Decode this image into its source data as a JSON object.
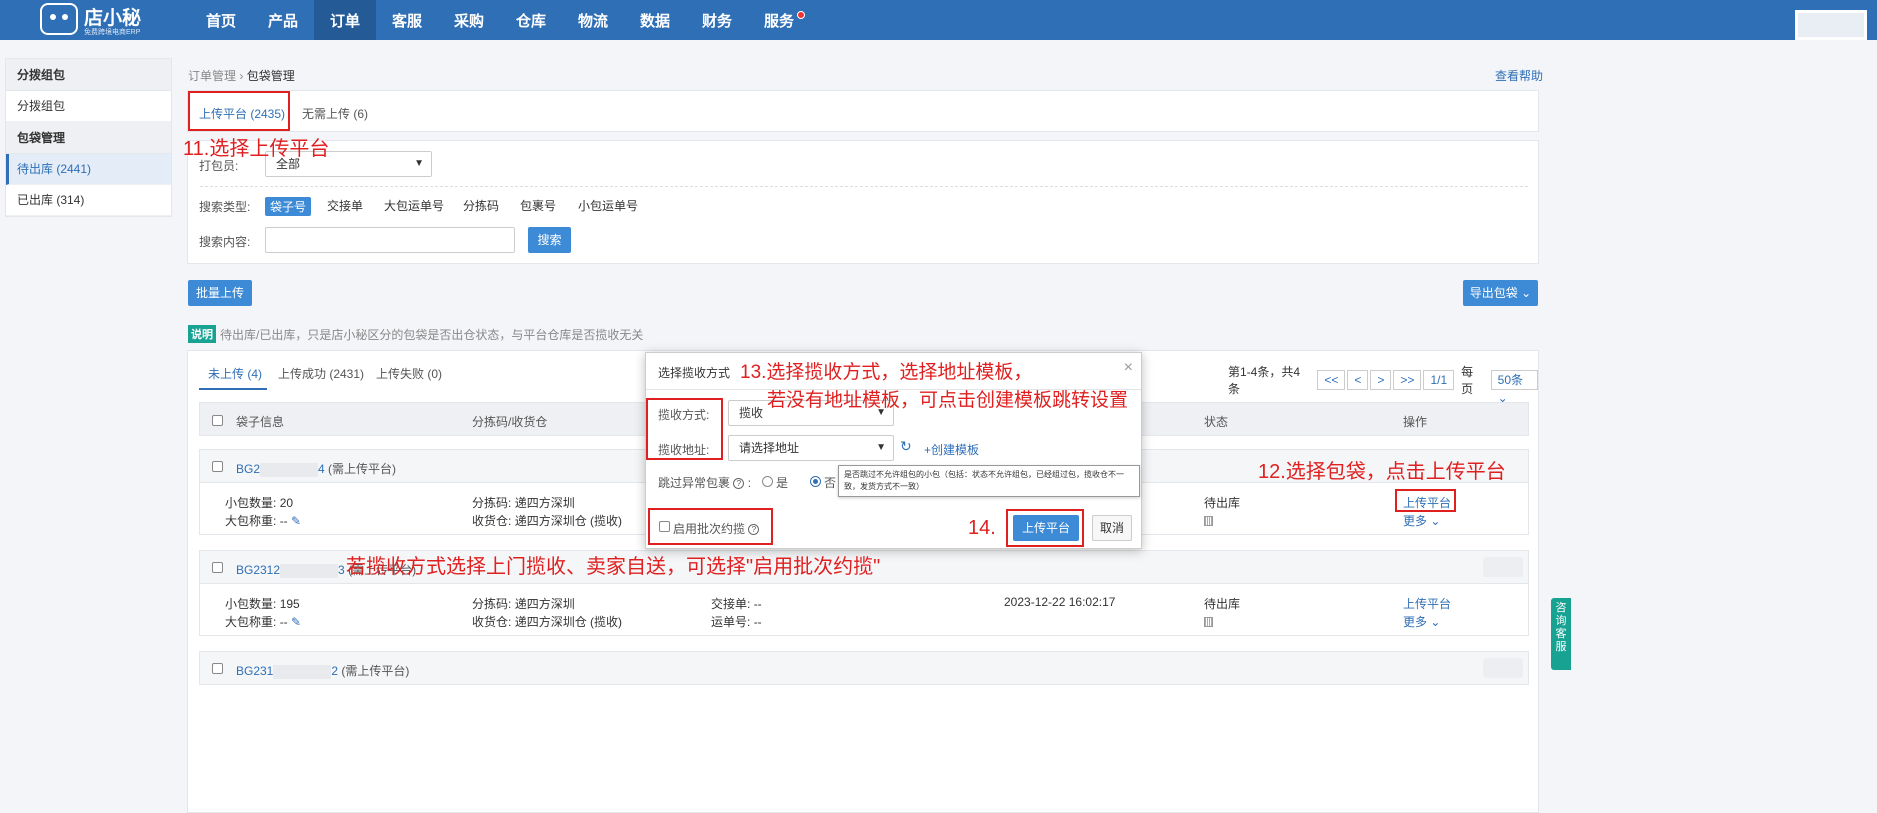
{
  "brand": {
    "name": "店小秘",
    "tagline": "免费跨境电商ERP"
  },
  "nav": [
    "首页",
    "产品",
    "订单",
    "客服",
    "采购",
    "仓库",
    "物流",
    "数据",
    "财务",
    "服务"
  ],
  "sidebar": {
    "groups": [
      {
        "title": "分拨组包",
        "items": [
          "分拨组包"
        ]
      },
      {
        "title": "包袋管理",
        "items": [
          "待出库 (2441)",
          "已出库 (314)"
        ]
      }
    ]
  },
  "breadcrumb": {
    "parent": "订单管理",
    "sep": "›",
    "current": "包袋管理"
  },
  "help_link": "查看帮助",
  "top_tabs": [
    "上传平台 (2435)",
    "无需上传 (6)"
  ],
  "filter": {
    "packer_label": "打包员:",
    "packer_value": "全部",
    "search_type_label": "搜索类型:",
    "search_types": [
      "袋子号",
      "交接单",
      "大包运单号",
      "分拣码",
      "包裹号",
      "小包运单号"
    ],
    "search_content_label": "搜索内容:",
    "search_button": "搜索"
  },
  "batch_upload": "批量上传",
  "export_bags": "导出包袋",
  "notice": {
    "tag": "说明",
    "text": "待出库/已出库，只是店小秘区分的包袋是否出仓状态，与平台仓库是否揽收无关"
  },
  "list_tabs": [
    "未上传 (4)",
    "上传成功 (2431)",
    "上传失败 (0)"
  ],
  "pager": {
    "summary": "第1-4条，共4条",
    "buttons": [
      "<<",
      "<",
      ">",
      ">>"
    ],
    "page": "1/1",
    "per_page_label": "每页",
    "per_page": "50条"
  },
  "columns": {
    "bag": "袋子信息",
    "sort": "分拣码/收货仓",
    "status": "状态",
    "actions": "操作"
  },
  "rows": [
    {
      "id_prefix": "BG2",
      "id_suffix": "4",
      "need": "(需上传平台)",
      "qty_label": "小包数量:",
      "qty": "20",
      "weight_label": "大包称重:",
      "weight": "--",
      "sort_label": "分拣码:",
      "sort": "递四方深圳",
      "wh_label": "收货仓:",
      "wh": "递四方深圳仓 (揽收)",
      "handover_label": "",
      "handover": "",
      "waybill_label": "",
      "waybill": "",
      "time": "",
      "status": "待出库",
      "upload": "上传平台",
      "more": "更多"
    },
    {
      "id_prefix": "BG2312",
      "id_suffix": "3",
      "need": "(需上传平台)",
      "qty_label": "小包数量:",
      "qty": "195",
      "weight_label": "大包称重:",
      "weight": "--",
      "sort_label": "分拣码:",
      "sort": "递四方深圳",
      "wh_label": "收货仓:",
      "wh": "递四方深圳仓 (揽收)",
      "handover_label": "交接单:",
      "handover": "--",
      "waybill_label": "运单号:",
      "waybill": "--",
      "time": "2023-12-22 16:02:17",
      "status": "待出库",
      "upload": "上传平台",
      "more": "更多"
    },
    {
      "id_prefix": "BG231",
      "id_suffix": "2",
      "need": "(需上传平台)"
    }
  ],
  "modal": {
    "title": "选择揽收方式",
    "method_label": "揽收方式:",
    "method_value": "揽收",
    "address_label": "揽收地址:",
    "address_value": "请选择地址",
    "create_template": "+创建模板",
    "skip_label": "跳过异常包裹",
    "yes": "是",
    "no": "否",
    "tooltip": "是否跳过不允许组包的小包（包括：状态不允许组包，已经组过包，揽收仓不一致，发货方式不一致）",
    "batch_label": "启用批次约揽",
    "confirm": "上传平台",
    "cancel": "取消"
  },
  "annotations": {
    "a11": "11.选择上传平台",
    "a12": "12.选择包袋，点击上传平台",
    "a13_1": "13.选择揽收方式，选择地址模板，",
    "a13_2": "若没有地址模板，可点击创建模板跳转设置",
    "a14": "14.",
    "note": "若揽收方式选择上门揽收、卖家自送，可选择\"启用批次约揽\""
  },
  "side_help": "咨询客服"
}
